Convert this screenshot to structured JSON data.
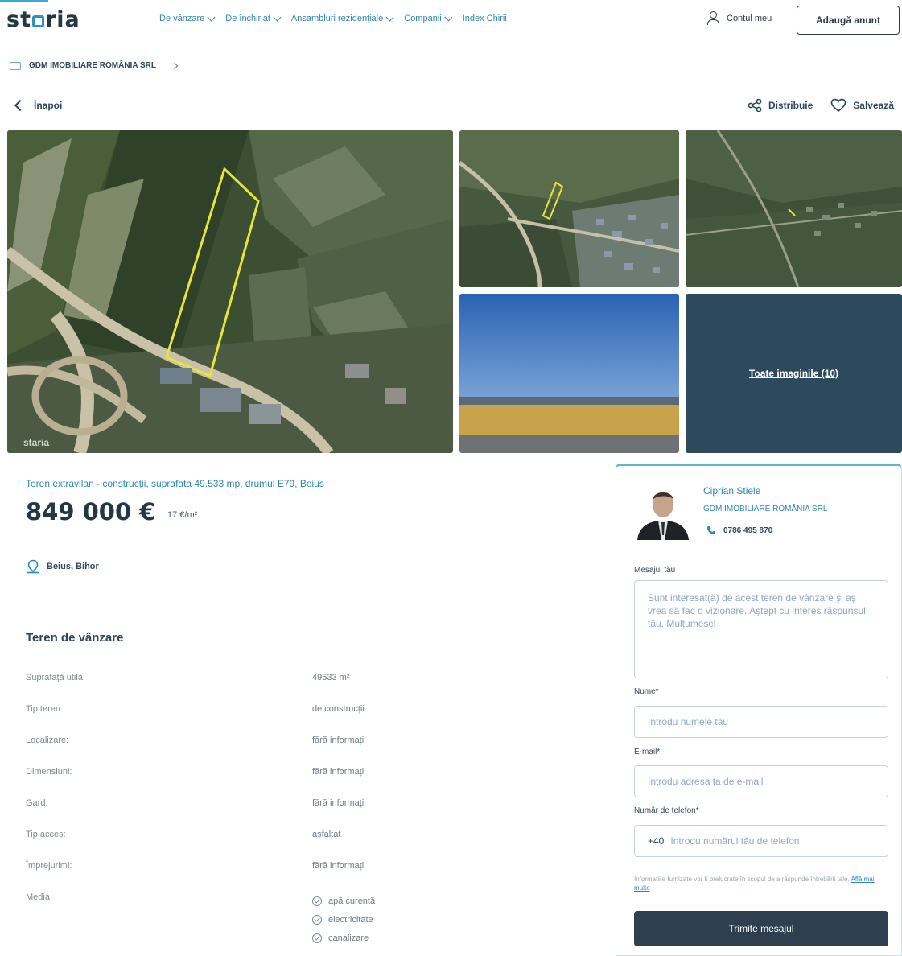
{
  "header": {
    "logo": "staria",
    "nav": [
      {
        "label": "De vânzare"
      },
      {
        "label": "De închiriat"
      },
      {
        "label": "Ansambluri rezidențiale"
      },
      {
        "label": "Companii"
      },
      {
        "label": "Index Chirii"
      }
    ],
    "account_label": "Contul meu",
    "add_listing_label": "Adaugă anunț"
  },
  "breadcrumb": {
    "agency": "GDM IMOBILIARE ROMÂNIA SRL"
  },
  "toolbar": {
    "back_label": "Înapoi",
    "share_label": "Distribuie",
    "save_label": "Salvează"
  },
  "gallery": {
    "all_images_label": "Toate imaginile (10)",
    "watermark": "staria"
  },
  "listing": {
    "title": "Teren extravilan - construcții, suprafata 49.533 mp, drumul E79, Beius",
    "price": "849 000 €",
    "price_per_m2": "17 €/m²",
    "location": "Beius, Bihor",
    "section_title": "Teren de vânzare",
    "specs": [
      {
        "key": "Suprafață utilă:",
        "value": "49533 m²"
      },
      {
        "key": "Tip teren:",
        "value": "de construcții"
      },
      {
        "key": "Localizare:",
        "value": "fără informații"
      },
      {
        "key": "Dimensiuni:",
        "value": "fără informații"
      },
      {
        "key": "Gard:",
        "value": "fără informații"
      },
      {
        "key": "Tip acces:",
        "value": "asfaltat"
      },
      {
        "key": "Împrejurimi:",
        "value": "fără informații"
      },
      {
        "key": "Media:",
        "value": ""
      }
    ],
    "utilities": [
      "apă curentă",
      "electricitate",
      "canalizare"
    ]
  },
  "contact": {
    "agent_name": "Ciprian Stiele",
    "agent_company": "GDM IMOBILIARE ROMÂNIA SRL",
    "agent_phone": "0786 495 870",
    "message_label": "Mesajul tău",
    "message_text": "Sunt interesat(ă) de acest teren de vânzare și aș vrea să fac o vizionare. Aștept cu interes răspunsul tău. Mulțumesc!",
    "name_label": "Nume*",
    "name_placeholder": "Introdu numele tău",
    "email_label": "E-mail*",
    "email_placeholder": "Introdu adresa ta de e-mail",
    "phone_label": "Număr de telefon*",
    "phone_prefix": "+40",
    "phone_placeholder": "Introdu numărul tău de telefon",
    "fine_print": "Informațiile furnizate vor fi prelucrate în scopul de a răspunde întrebării tale.",
    "fine_print_link": "Află mai multe",
    "send_label": "Trimite mesajul"
  },
  "colors": {
    "accent_blue": "#2e86b5",
    "dark_button": "#2e4050",
    "panel_border_top": "#5fb7d3"
  }
}
